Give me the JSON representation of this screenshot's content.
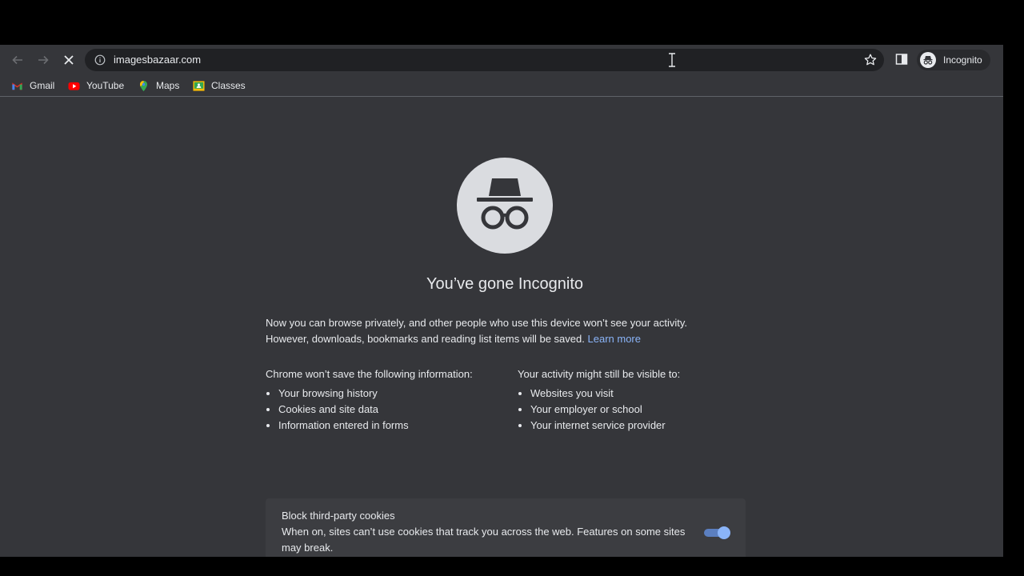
{
  "toolbar": {
    "back_icon": "back-arrow-icon",
    "forward_icon": "forward-arrow-icon",
    "stop_icon": "close-icon",
    "url": "imagesbazaar.com",
    "profile_label": "Incognito"
  },
  "bookmarks": [
    {
      "label": "Gmail",
      "icon": "gmail-icon"
    },
    {
      "label": "YouTube",
      "icon": "youtube-icon"
    },
    {
      "label": "Maps",
      "icon": "maps-icon"
    },
    {
      "label": "Classes",
      "icon": "classes-icon"
    }
  ],
  "page": {
    "headline": "You’ve gone Incognito",
    "intro_line1": "Now you can browse privately, and other people who use this device won’t see your activity.",
    "intro_line2": "However, downloads, bookmarks and reading list items will be saved.",
    "learn_more": "Learn more",
    "left_heading": "Chrome won’t save the following information:",
    "left_items": [
      "Your browsing history",
      "Cookies and site data",
      "Information entered in forms"
    ],
    "right_heading": "Your activity might still be visible to:",
    "right_items": [
      "Websites you visit",
      "Your employer or school",
      "Your internet service provider"
    ],
    "cookie_title": "Block third-party cookies",
    "cookie_desc": "When on, sites can’t use cookies that track you across the web. Features on some sites may break.",
    "cookie_toggle_on": true
  },
  "colors": {
    "background": "#35363a",
    "omnibox": "#202124",
    "link": "#8ab4f8",
    "toggle": "#8ab4f8"
  }
}
